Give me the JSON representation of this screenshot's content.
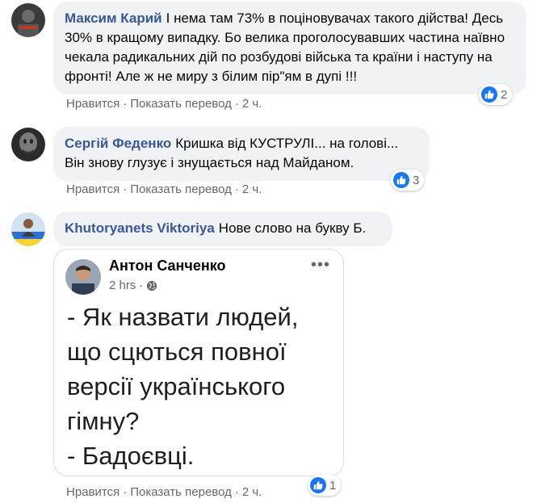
{
  "comments": [
    {
      "author": "Максим Карий",
      "text": "І нема там 73% в поціновувачах такого дійства! Десь 30% в кращому випадку. Бо велика проголосувавших частина наївно чекала радикальних дій по розбудові війська та країни і наступу на фронті! Але ж не миру з білим пір\"ям в дупі !!!",
      "actions": {
        "like": "Нравится",
        "translate": "Показать перевод",
        "time": "2 ч."
      },
      "reaction_count": "2"
    },
    {
      "author": "Сергій Феденко",
      "text": "Кришка від КУСТРУЛІ... на голові... Він знову глузує і знущається над Майданом.",
      "actions": {
        "like": "Нравится",
        "translate": "Показать перевод",
        "time": "2 ч."
      },
      "reaction_count": "3"
    },
    {
      "author": "Khutoryanets Viktoriya",
      "text": "Нове слово на букву Б.",
      "actions": {
        "like": "Нравится",
        "translate": "Показать перевод",
        "time": "2 ч."
      },
      "reaction_count": "1",
      "attachment": {
        "author": "Антон Санченко",
        "time": "2 hrs",
        "menu": "•••",
        "lines": [
          "- Як назвати людей,",
          "що сцються повної",
          "версії українського",
          "гімну?",
          "- Бадоєвці."
        ]
      }
    }
  ],
  "separator": "·",
  "colors": {
    "author": "#385898",
    "bubble": "#f0f2f5",
    "meta": "#65676b",
    "like": "#1877f2"
  }
}
